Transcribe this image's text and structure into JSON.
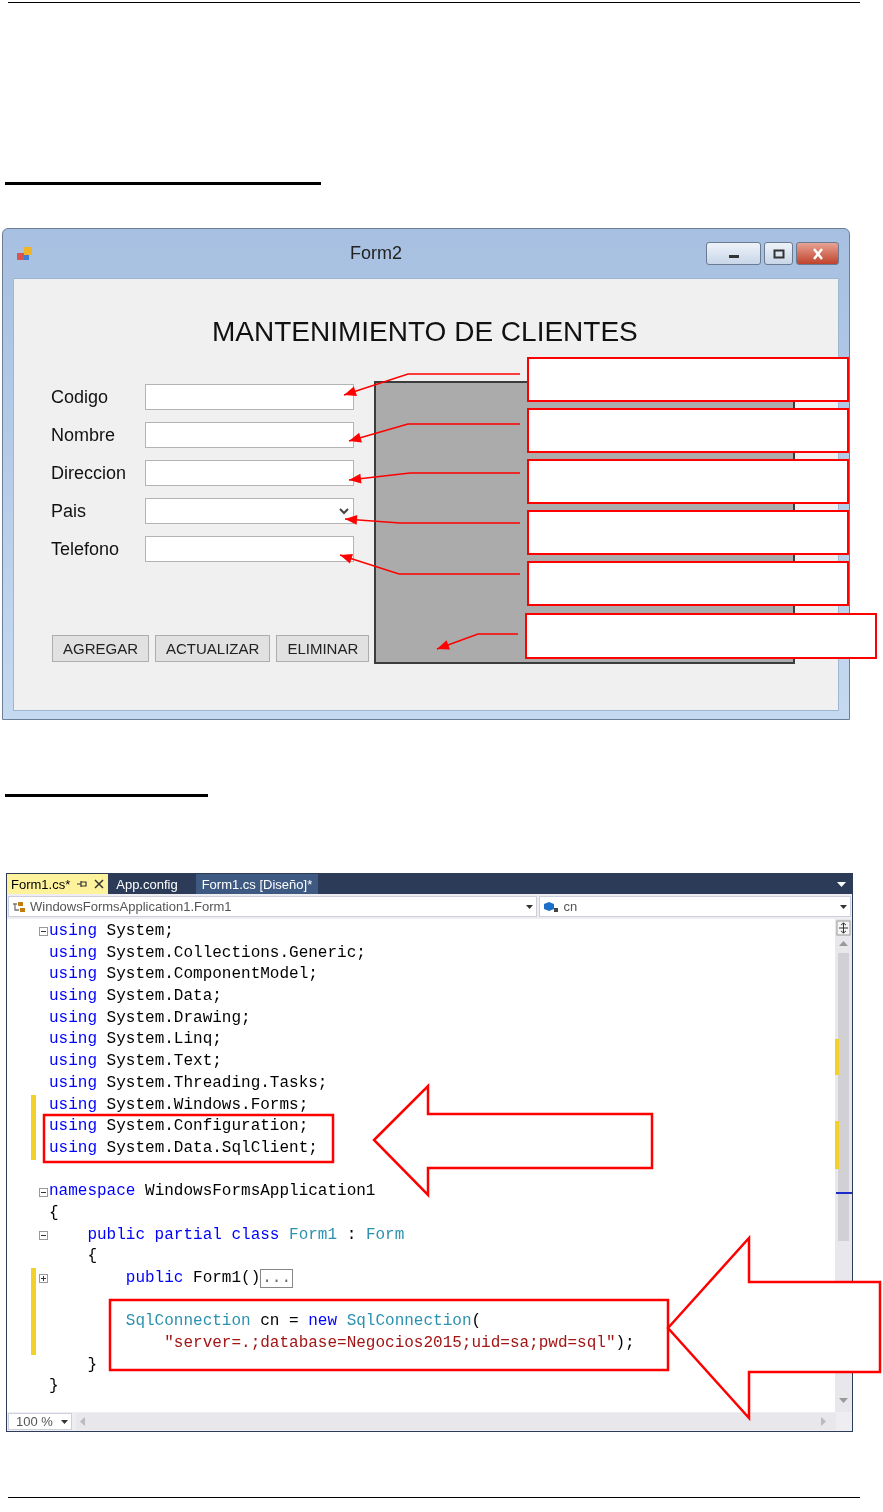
{
  "form_window": {
    "title": "Form2",
    "heading": "MANTENIMIENTO DE CLIENTES",
    "fields": [
      {
        "label": "Codigo",
        "kind": "text"
      },
      {
        "label": "Nombre",
        "kind": "text"
      },
      {
        "label": "Direccion",
        "kind": "text"
      },
      {
        "label": "Pais",
        "kind": "dropdown"
      },
      {
        "label": "Telefono",
        "kind": "text"
      }
    ],
    "buttons": [
      "AGREGAR",
      "ACTUALIZAR",
      "ELIMINAR"
    ]
  },
  "editor": {
    "tabs": [
      {
        "label": "Form1.cs*",
        "selected": true
      },
      {
        "label": "App.config",
        "selected": false
      },
      {
        "label": "Form1.cs [Diseño]*",
        "selected": false
      }
    ],
    "type_selector": "WindowsFormsApplication1.Form1",
    "member_selector": "cn",
    "lines": [
      {
        "expanded": true,
        "changed": false,
        "segments": [
          {
            "text": "using",
            "kind": "keyword"
          },
          {
            "text": " System;",
            "kind": "plain"
          }
        ]
      },
      {
        "changed": false,
        "segments": [
          {
            "text": "using",
            "kind": "keyword"
          },
          {
            "text": " System.Collections.Generic;",
            "kind": "plain"
          }
        ]
      },
      {
        "changed": false,
        "segments": [
          {
            "text": "using",
            "kind": "keyword"
          },
          {
            "text": " System.ComponentModel;",
            "kind": "plain"
          }
        ]
      },
      {
        "changed": false,
        "segments": [
          {
            "text": "using",
            "kind": "keyword"
          },
          {
            "text": " System.Data;",
            "kind": "plain"
          }
        ]
      },
      {
        "changed": false,
        "segments": [
          {
            "text": "using",
            "kind": "keyword"
          },
          {
            "text": " System.Drawing;",
            "kind": "plain"
          }
        ]
      },
      {
        "changed": false,
        "segments": [
          {
            "text": "using",
            "kind": "keyword"
          },
          {
            "text": " System.Linq;",
            "kind": "plain"
          }
        ]
      },
      {
        "changed": false,
        "segments": [
          {
            "text": "using",
            "kind": "keyword"
          },
          {
            "text": " System.Text;",
            "kind": "plain"
          }
        ]
      },
      {
        "changed": false,
        "segments": [
          {
            "text": "using",
            "kind": "keyword"
          },
          {
            "text": " System.Threading.Tasks;",
            "kind": "plain"
          }
        ]
      },
      {
        "changed": true,
        "segments": [
          {
            "text": "using",
            "kind": "keyword"
          },
          {
            "text": " System.Windows.Forms;",
            "kind": "plain"
          }
        ]
      },
      {
        "changed": true,
        "segments": [
          {
            "text": "using",
            "kind": "keyword"
          },
          {
            "text": " System.Configuration;",
            "kind": "plain"
          }
        ]
      },
      {
        "changed": true,
        "segments": [
          {
            "text": "using",
            "kind": "keyword"
          },
          {
            "text": " System.Data.SqlClient;",
            "kind": "plain"
          }
        ]
      },
      {
        "changed": false
      },
      {
        "expanded": true,
        "changed": false,
        "segments": [
          {
            "text": "namespace",
            "kind": "keyword"
          },
          {
            "text": " WindowsFormsApplication1",
            "kind": "plain"
          }
        ]
      },
      {
        "changed": false,
        "segments": [
          {
            "text": "{",
            "kind": "plain"
          }
        ]
      },
      {
        "expanded": true,
        "changed": false,
        "segments": [
          {
            "text": "    public partial class ",
            "kind": "keyword"
          },
          {
            "text": "Form1",
            "kind": "type"
          },
          {
            "text": " : ",
            "kind": "plain"
          },
          {
            "text": "Form",
            "kind": "type"
          }
        ]
      },
      {
        "changed": false,
        "segments": [
          {
            "text": "    {",
            "kind": "plain"
          }
        ]
      },
      {
        "expanded": false,
        "changed": true,
        "segments": [
          {
            "text": "        public",
            "kind": "keyword"
          },
          {
            "text": " Form1()",
            "kind": "plain"
          }
        ],
        "collapsed": "..."
      },
      {
        "changed": true
      },
      {
        "changed": true,
        "segments": [
          {
            "text": "        SqlConnection",
            "kind": "type"
          },
          {
            "text": " cn = ",
            "kind": "plain"
          },
          {
            "text": "new ",
            "kind": "keyword"
          },
          {
            "text": "SqlConnection",
            "kind": "type"
          },
          {
            "text": "(",
            "kind": "plain"
          }
        ]
      },
      {
        "changed": true,
        "segments": [
          {
            "text": "            \"server=.;database=Negocios2015;uid=sa;pwd=sql\"",
            "kind": "string"
          },
          {
            "text": ");",
            "kind": "plain"
          }
        ]
      },
      {
        "changed": false,
        "segments": [
          {
            "text": "    }",
            "kind": "plain"
          }
        ]
      },
      {
        "changed": false,
        "segments": [
          {
            "text": "}",
            "kind": "plain"
          }
        ]
      }
    ],
    "zoom": "100 %"
  }
}
